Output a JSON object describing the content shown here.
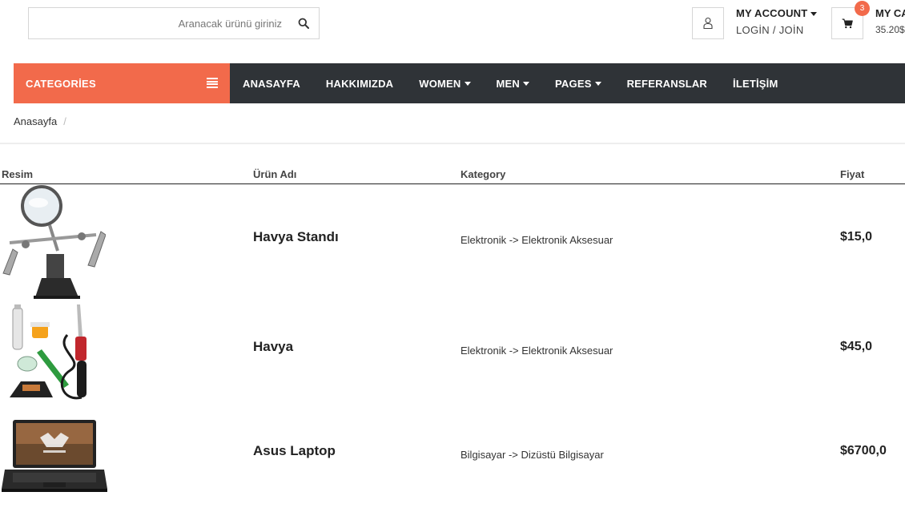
{
  "header": {
    "search_placeholder": "Aranacak ürünü giriniz",
    "account_title": "MY ACCOUNT",
    "account_sub": "LOGİN / JOİN",
    "cart_title": "MY CA",
    "cart_total": "35.20$",
    "cart_count": "3"
  },
  "nav": {
    "categories_label": "CATEGORİES",
    "items": [
      {
        "label": "ANASAYFA"
      },
      {
        "label": "HAKKIMIZDA"
      },
      {
        "label": "WOMEN"
      },
      {
        "label": "MEN"
      },
      {
        "label": "PAGES"
      },
      {
        "label": "REFERANSLAR"
      },
      {
        "label": "İLETİŞİM"
      }
    ]
  },
  "breadcrumb": {
    "home": "Anasayfa",
    "separator": "/"
  },
  "table": {
    "headers": [
      "Resim",
      "Ürün Adı",
      "Kategory",
      "Fiyat"
    ],
    "rows": [
      {
        "image": "soldering-stand-icon",
        "name": "Havya Standı",
        "category": "Elektronik -> Elektronik Aksesuar",
        "price": "$15,0"
      },
      {
        "image": "soldering-iron-icon",
        "name": "Havya",
        "category": "Elektronik -> Elektronik Aksesuar",
        "price": "$45,0"
      },
      {
        "image": "laptop-icon",
        "name": "Asus Laptop",
        "category": "Bilgisayar -> Dizüstü Bilgisayar",
        "price": "$6700,0"
      }
    ]
  },
  "colors": {
    "accent": "#f26a4b",
    "nav_bg": "#2f3337"
  }
}
